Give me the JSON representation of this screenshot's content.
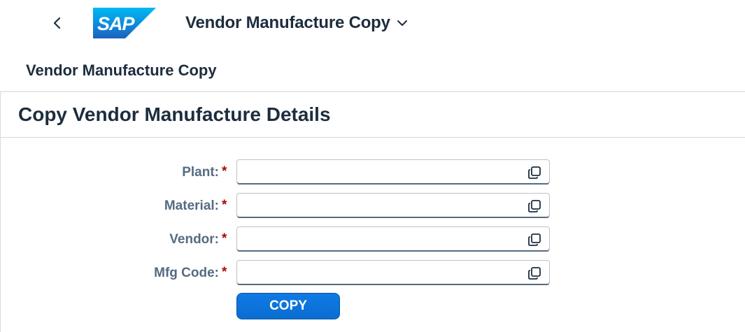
{
  "shell": {
    "back_label": "Back",
    "logo_text": "SAP",
    "app_title": "Vendor Manufacture Copy",
    "brand_color": "#0a6ed1"
  },
  "page": {
    "header_title": "Vendor Manufacture Copy",
    "section_title": "Copy Vendor Manufacture Details"
  },
  "form": {
    "fields": [
      {
        "label": "Plant:",
        "required_mark": "*",
        "value": "",
        "icon": "value-help-icon"
      },
      {
        "label": "Material:",
        "required_mark": "*",
        "value": "",
        "icon": "value-help-icon"
      },
      {
        "label": "Vendor:",
        "required_mark": "*",
        "value": "",
        "icon": "value-help-icon"
      },
      {
        "label": "Mfg Code:",
        "required_mark": "*",
        "value": "",
        "icon": "value-help-icon"
      }
    ],
    "copy_button_label": "COPY"
  }
}
